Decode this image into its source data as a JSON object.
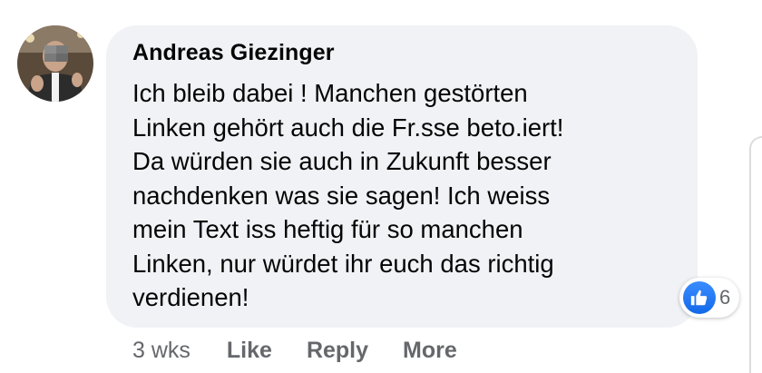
{
  "comment": {
    "author": "Andreas Giezinger",
    "text": "Ich bleib dabei ! Manchen gestörten\nLinken gehört auch die Fr.sse beto.iert!\nDa würden sie auch in Zukunft besser\nnachdenken was sie sagen! Ich weiss\nmein Text iss heftig für so manchen\nLinken, nur würdet ihr euch das richtig\nverdienen!",
    "timestamp": "3 wks",
    "actions": {
      "like": "Like",
      "reply": "Reply",
      "more": "More"
    },
    "reactions": {
      "icon": "like-thumb-icon",
      "count": "6"
    }
  },
  "colors": {
    "bubble": "#f0f2f5",
    "text": "#050505",
    "secondary": "#65676b",
    "like_blue": "#1877f2"
  }
}
